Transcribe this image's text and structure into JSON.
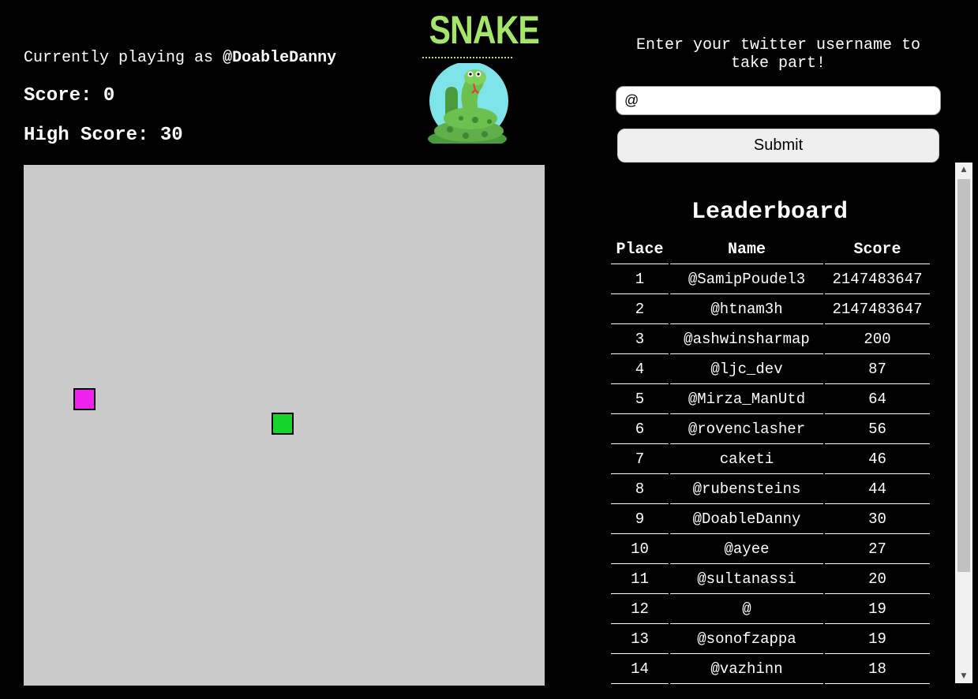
{
  "player": {
    "prefix": "Currently playing as",
    "name": "@DoableDanny"
  },
  "score": {
    "label": "Score: 0"
  },
  "high_score": {
    "label": "High Score: 30"
  },
  "logo": {
    "title": "SNAKE"
  },
  "colors": {
    "board": "#cacaca",
    "food": "#ee22ee",
    "snake": "#15d42a",
    "logo": "#a6e56b"
  },
  "form": {
    "prompt": "Enter your twitter username to take part!",
    "input_value": "@",
    "submit_label": "Submit"
  },
  "leaderboard": {
    "title": "Leaderboard",
    "headers": [
      "Place",
      "Name",
      "Score"
    ],
    "rows": [
      {
        "place": "1",
        "name": "@SamipPoudel3",
        "score": "2147483647"
      },
      {
        "place": "2",
        "name": "@htnam3h",
        "score": "2147483647"
      },
      {
        "place": "3",
        "name": "@ashwinsharmap",
        "score": "200"
      },
      {
        "place": "4",
        "name": "@ljc_dev",
        "score": "87"
      },
      {
        "place": "5",
        "name": "@Mirza_ManUtd",
        "score": "64"
      },
      {
        "place": "6",
        "name": "@rovenclasher",
        "score": "56"
      },
      {
        "place": "7",
        "name": "caketi",
        "score": "46"
      },
      {
        "place": "8",
        "name": "@rubensteins",
        "score": "44"
      },
      {
        "place": "9",
        "name": "@DoableDanny",
        "score": "30"
      },
      {
        "place": "10",
        "name": "@ayee",
        "score": "27"
      },
      {
        "place": "11",
        "name": "@sultanassi",
        "score": "20"
      },
      {
        "place": "12",
        "name": "@",
        "score": "19"
      },
      {
        "place": "13",
        "name": "@sonofzappa",
        "score": "19"
      },
      {
        "place": "14",
        "name": "@vazhinn",
        "score": "18"
      }
    ]
  }
}
